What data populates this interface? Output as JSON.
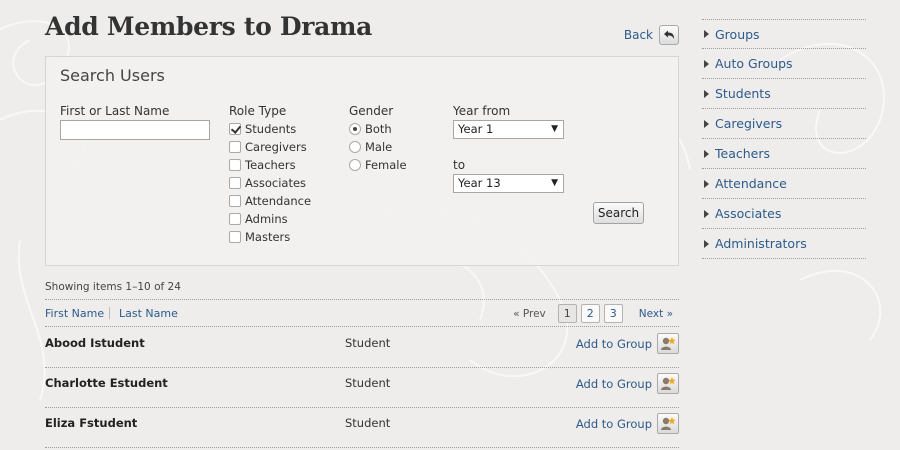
{
  "page": {
    "title": "Add Members to Drama",
    "back_label": "Back"
  },
  "search": {
    "title": "Search Users",
    "name_label": "First or Last Name",
    "name_value": "",
    "role_label": "Role Type",
    "roles": [
      {
        "label": "Students",
        "checked": true
      },
      {
        "label": "Caregivers",
        "checked": false
      },
      {
        "label": "Teachers",
        "checked": false
      },
      {
        "label": "Associates",
        "checked": false
      },
      {
        "label": "Attendance",
        "checked": false
      },
      {
        "label": "Admins",
        "checked": false
      },
      {
        "label": "Masters",
        "checked": false
      }
    ],
    "gender_label": "Gender",
    "genders": [
      {
        "label": "Both",
        "selected": true
      },
      {
        "label": "Male",
        "selected": false
      },
      {
        "label": "Female",
        "selected": false
      }
    ],
    "year_from_label": "Year from",
    "year_from_value": "Year 1",
    "year_to_label": "to",
    "year_to_value": "Year 13",
    "search_button": "Search"
  },
  "results": {
    "showing": "Showing items 1–10 of 24",
    "sort_first": "First Name",
    "sort_last": "Last Name",
    "prev": "« Prev",
    "pages": [
      "1",
      "2",
      "3"
    ],
    "current_page": "1",
    "next": "Next »",
    "add_label": "Add to Group",
    "rows": [
      {
        "name": "Abood Istudent",
        "role": "Student"
      },
      {
        "name": "Charlotte Estudent",
        "role": "Student"
      },
      {
        "name": "Eliza Fstudent",
        "role": "Student"
      }
    ]
  },
  "sidebar": {
    "items": [
      {
        "label": "Groups"
      },
      {
        "label": "Auto Groups"
      },
      {
        "label": "Students"
      },
      {
        "label": "Caregivers"
      },
      {
        "label": "Teachers"
      },
      {
        "label": "Attendance"
      },
      {
        "label": "Associates"
      },
      {
        "label": "Administrators"
      }
    ]
  },
  "colors": {
    "link": "#2c5a8c",
    "background": "#eeedeb"
  }
}
